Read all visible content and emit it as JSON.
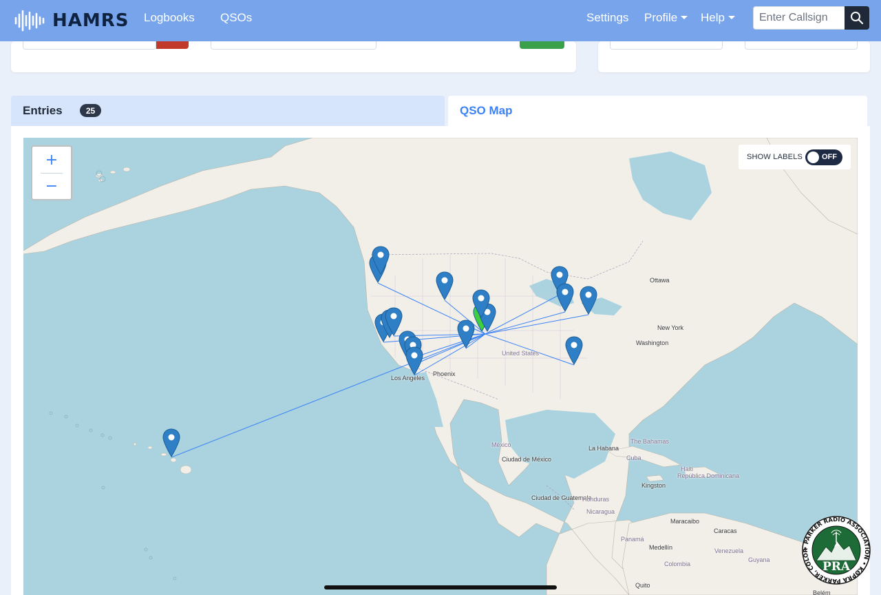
{
  "navbar": {
    "brand": "HAMRS",
    "links": [
      "Logbooks",
      "QSOs"
    ],
    "right_links": [
      {
        "label": "Settings",
        "dropdown": false
      },
      {
        "label": "Profile",
        "dropdown": true
      },
      {
        "label": "Help",
        "dropdown": true
      }
    ],
    "search_placeholder": "Enter Callsign"
  },
  "tabs": {
    "entries_label": "Entries",
    "entries_count": "25",
    "map_label": "QSO Map"
  },
  "map": {
    "zoom_in": "+",
    "zoom_out": "−",
    "show_labels": "SHOW LABELS",
    "toggle_state": "OFF",
    "place_labels": [
      {
        "name": "Ottawa",
        "type": "city"
      },
      {
        "name": "New York",
        "type": "city"
      },
      {
        "name": "Washington",
        "type": "city"
      },
      {
        "name": "United States",
        "type": "country"
      },
      {
        "name": "Phoenix",
        "type": "city"
      },
      {
        "name": "Los Angeles",
        "type": "city"
      },
      {
        "name": "México",
        "type": "country"
      },
      {
        "name": "Ciudad de México",
        "type": "city"
      },
      {
        "name": "La Habana",
        "type": "city"
      },
      {
        "name": "Cuba",
        "type": "country"
      },
      {
        "name": "The Bahamas",
        "type": "country"
      },
      {
        "name": "Haiti",
        "type": "country"
      },
      {
        "name": "República Dominicana",
        "type": "country"
      },
      {
        "name": "Kingston",
        "type": "city"
      },
      {
        "name": "Ciudad de Guatemala",
        "type": "city"
      },
      {
        "name": "Honduras",
        "type": "country"
      },
      {
        "name": "Nicaragua",
        "type": "country"
      },
      {
        "name": "Panamá",
        "type": "country"
      },
      {
        "name": "Maracaibo",
        "type": "city"
      },
      {
        "name": "Caracas",
        "type": "city"
      },
      {
        "name": "Medellín",
        "type": "city"
      },
      {
        "name": "Venezuela",
        "type": "country"
      },
      {
        "name": "Colombia",
        "type": "country"
      },
      {
        "name": "Guyana",
        "type": "country"
      },
      {
        "name": "Quito",
        "type": "city"
      },
      {
        "name": "Belém",
        "type": "city"
      }
    ]
  },
  "logo": {
    "text": "PRA",
    "ring_text": "• PARKER RADIO ASSOCIATION • KØPRA PARKER, COLORADO"
  },
  "colors": {
    "navbar": "#77a4ea",
    "accent": "#3b82f6",
    "marker": "#2f7fc6",
    "home_marker": "#3fcf3f",
    "logo_green": "#1d6b36"
  }
}
